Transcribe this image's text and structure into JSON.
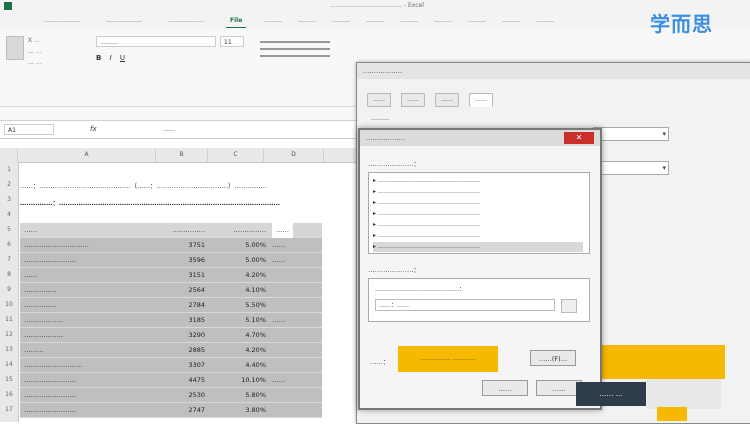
{
  "titlebar": {
    "tabs": [
      "………………",
      "………………",
      "………………",
      "File",
      "………",
      "………",
      "………",
      "………",
      "………",
      "………",
      "………",
      "………",
      "………"
    ],
    "active_tab_index": 3,
    "window_title": "……………………………… - Excel"
  },
  "ribbon": {
    "clipboard_items": [
      "X …",
      "… …",
      "… …"
    ],
    "font_name": "………",
    "font_size": "11"
  },
  "formula_bar": {
    "name_box": "A1",
    "fx": "fx",
    "content": "……"
  },
  "sheet": {
    "columns": [
      "A",
      "B",
      "C",
      "D"
    ],
    "rows": [
      "1",
      "2",
      "3",
      "4",
      "5",
      "6",
      "7",
      "8",
      "9",
      "10",
      "11",
      "12",
      "13",
      "14",
      "15",
      "16",
      "17"
    ],
    "notes": [
      "……：……………………………………（……：……………………………）……………",
      "……………：…………………………………………………………………………………………"
    ],
    "table_header": [
      "……",
      "……………",
      "……………",
      "……"
    ],
    "table_rows": [
      [
        "…………………………",
        "3751",
        "5.00%",
        "……"
      ],
      [
        "……………………",
        "3596",
        "5.00%",
        "……"
      ],
      [
        "……",
        "3151",
        "4.20%",
        ""
      ],
      [
        "……………",
        "2564",
        "4.10%",
        ""
      ],
      [
        "……………",
        "2784",
        "5.50%",
        ""
      ],
      [
        "………………",
        "3185",
        "5.10%",
        "……"
      ],
      [
        "………………",
        "3290",
        "4.70%",
        ""
      ],
      [
        "………",
        "2885",
        "4.20%",
        ""
      ],
      [
        "………………………",
        "3307",
        "4.40%",
        ""
      ],
      [
        "……………………",
        "4475",
        "10.10%",
        "……"
      ],
      [
        "……………………",
        "2530",
        "5.80%",
        ""
      ],
      [
        "……………………",
        "2747",
        "3.80%",
        ""
      ]
    ]
  },
  "dialog_back": {
    "title": "………………",
    "tabs": [
      "……",
      "……",
      "……",
      "……"
    ],
    "active_tab_index": 3,
    "field_label": "………"
  },
  "dialog_front": {
    "title": "………………",
    "list_label": "…………………：",
    "list_items": [
      "……………………………………………",
      "……………………………………………",
      "……………………………………………",
      "……………………………………………",
      "……………………………………………",
      "……………………………………………",
      "……………………………………………"
    ],
    "selected_item_index": 6,
    "format_label": "…………………：",
    "format_sublabel": "……………………………………：",
    "format_value": "……：……",
    "preview_label": "……：",
    "preview_sample": "…………… …………",
    "format_button": "……(F)…",
    "ok_button": "……",
    "cancel_button": "……"
  },
  "watermark": {
    "text": "学而思"
  },
  "logo": {
    "text": "…… …"
  },
  "colors": {
    "highlight_yellow": "#f7b900",
    "excel_green": "#1e7145",
    "close_red": "#c9302c",
    "selection_gray": "#bfbfbf"
  }
}
